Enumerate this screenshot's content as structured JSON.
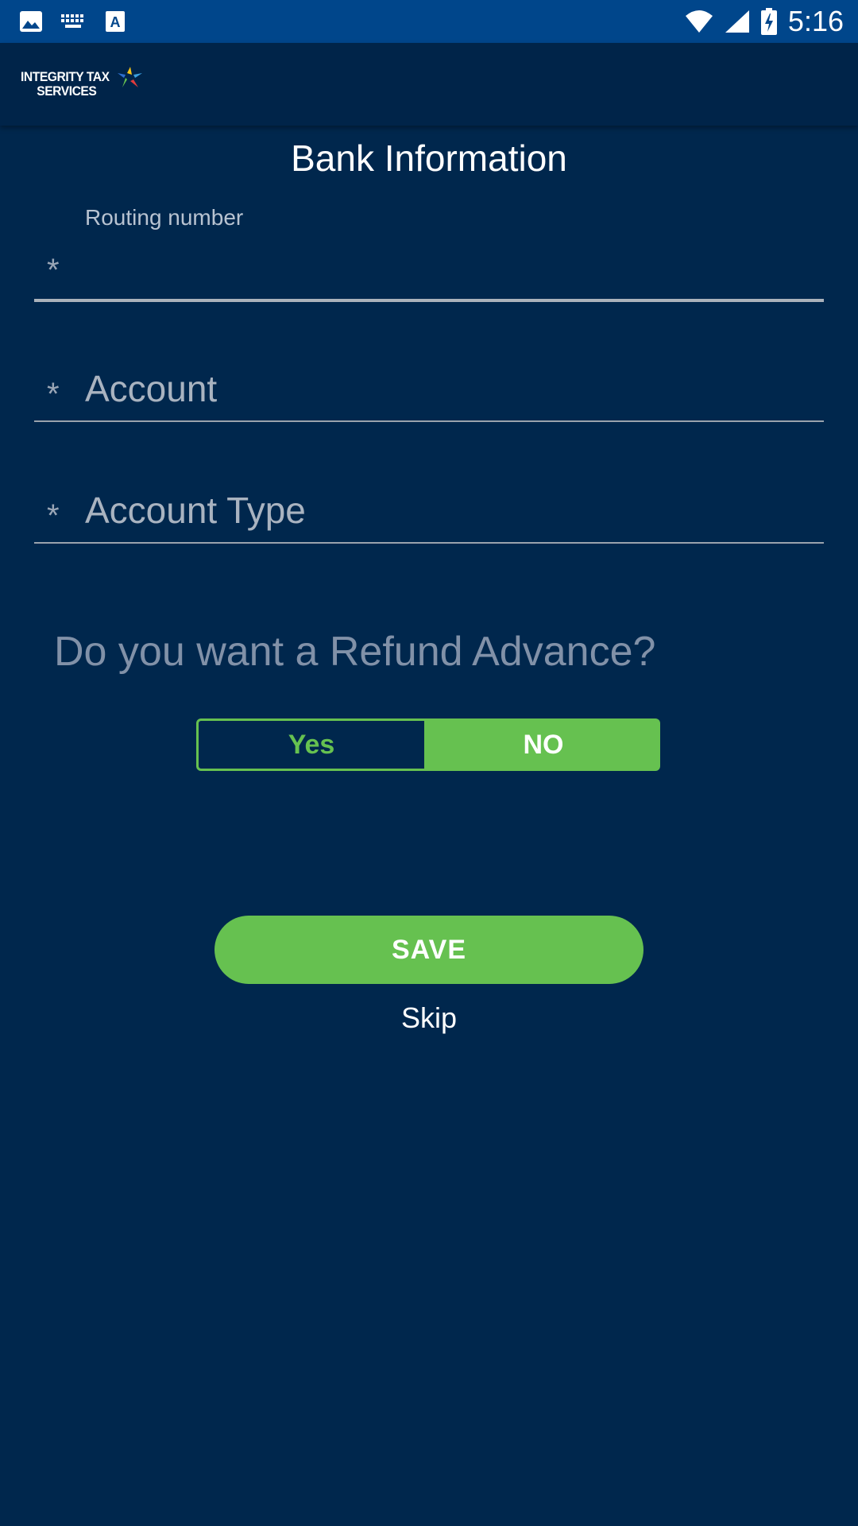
{
  "status_bar": {
    "time": "5:16",
    "icons_left": [
      "image-icon",
      "keyboard-icon",
      "font-icon"
    ],
    "icons_right": [
      "wifi-icon",
      "signal-icon",
      "battery-icon"
    ],
    "color": "#00468b"
  },
  "app_bar": {
    "logo_line1": "INTEGRITY TAX",
    "logo_line2": "SERVICES",
    "background": "#002449"
  },
  "page": {
    "title": "Bank Information"
  },
  "form": {
    "routing": {
      "label": "Routing number",
      "required_mark": "*",
      "value": ""
    },
    "account": {
      "placeholder": "Account",
      "required_mark": "*"
    },
    "account_type": {
      "placeholder": "Account Type",
      "required_mark": "*"
    }
  },
  "refund_advance": {
    "question": "Do you want a Refund Advance?",
    "options": [
      "Yes",
      "NO"
    ],
    "selected": "NO"
  },
  "actions": {
    "save_label": "SAVE",
    "skip_label": "Skip"
  },
  "colors": {
    "background": "#00274d",
    "accent_green": "#66c150"
  }
}
